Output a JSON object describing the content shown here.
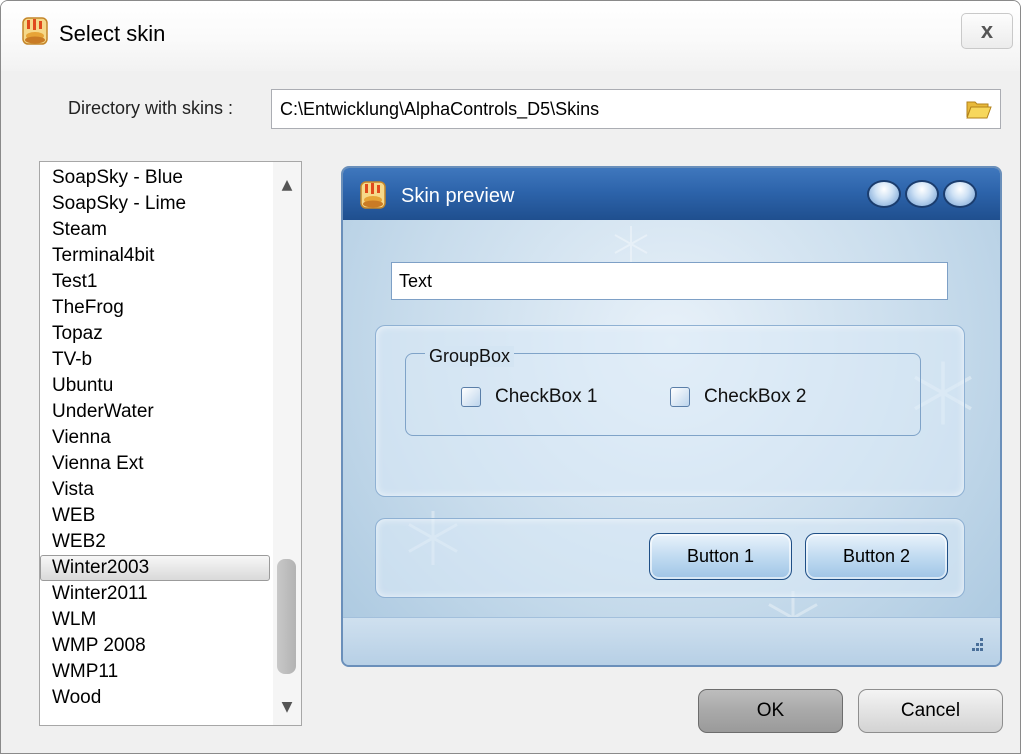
{
  "window": {
    "title": "Select skin",
    "close_label": "x"
  },
  "directory": {
    "label": "Directory with skins :",
    "value": "C:\\Entwicklung\\AlphaControls_D5\\Skins"
  },
  "skin_list": {
    "items": [
      "SoapSky - Blue",
      "SoapSky - Lime",
      "Steam",
      "Terminal4bit",
      "Test1",
      "TheFrog",
      "Topaz",
      "TV-b",
      "Ubuntu",
      "UnderWater",
      "Vienna",
      "Vienna Ext",
      "Vista",
      "WEB",
      "WEB2",
      "Winter2003",
      "Winter2011",
      "WLM",
      "WMP 2008",
      "WMP11",
      "Wood"
    ],
    "selected": "Winter2003"
  },
  "preview": {
    "title": "Skin preview",
    "text_field": "Text",
    "groupbox_label": "GroupBox",
    "checkbox1": "CheckBox 1",
    "checkbox2": "CheckBox 2",
    "button1": "Button 1",
    "button2": "Button 2"
  },
  "dialog": {
    "ok_label": "OK",
    "cancel_label": "Cancel"
  },
  "colors": {
    "preview_title_bar": "#2d64ab",
    "preview_background": "#c8dcec",
    "ok_button": "#a9a9a9"
  }
}
